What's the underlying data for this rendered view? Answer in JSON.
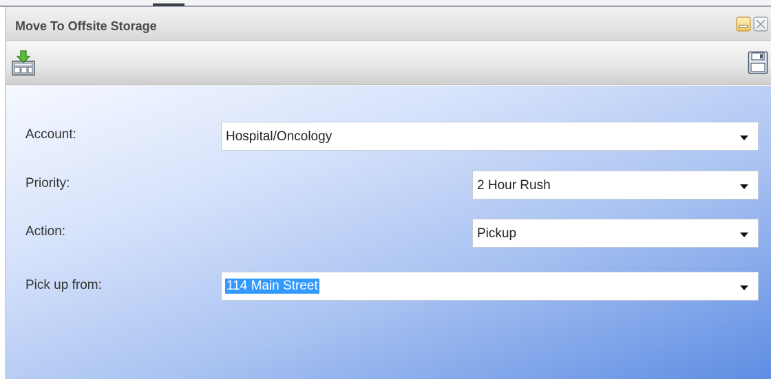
{
  "window": {
    "title": "Move To Offsite Storage",
    "buttons": {
      "minimize_icon": "minimize-icon",
      "close_icon": "close-icon"
    }
  },
  "toolbar": {
    "move_icon": "move-to-storage-icon",
    "save_icon": "save-icon"
  },
  "form": {
    "account": {
      "label": "Account:",
      "value": "Hospital/Oncology"
    },
    "priority": {
      "label": "Priority:",
      "value": "2 Hour Rush"
    },
    "action": {
      "label": "Action:",
      "value": "Pickup"
    },
    "pick_up_from": {
      "label": "Pick up from:",
      "value": "114 Main Street"
    }
  },
  "colors": {
    "selection": "#3399ff",
    "form_gradient_start": "#f5f8ff",
    "form_gradient_end": "#5f8de3"
  }
}
